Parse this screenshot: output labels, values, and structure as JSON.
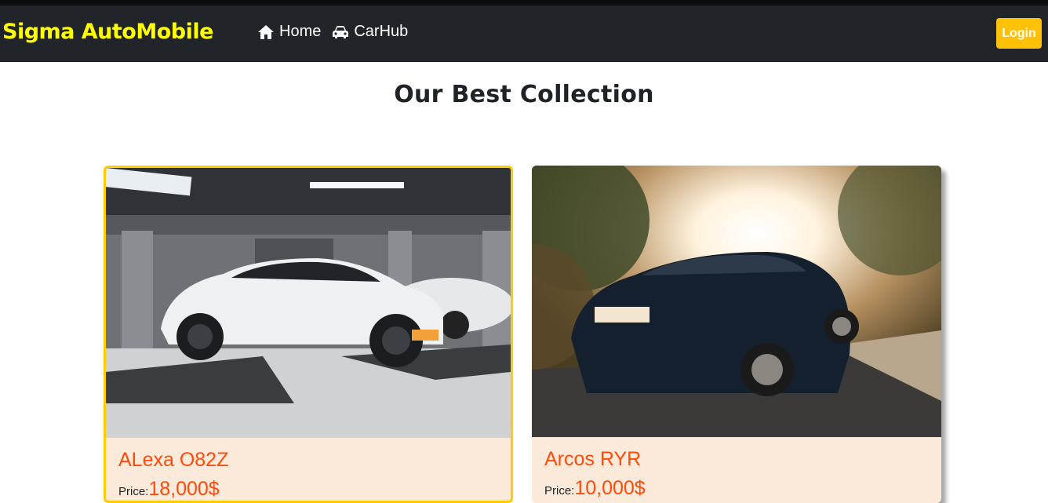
{
  "navbar": {
    "brand": "Sigma AutoMobile",
    "links": [
      {
        "label": "Home",
        "icon": "home-icon"
      },
      {
        "label": "CarHub",
        "icon": "car-icon"
      }
    ],
    "login_label": "Login",
    "colors": {
      "background": "#212529",
      "brand": "#ffff00",
      "login": "#ffc107"
    }
  },
  "main": {
    "heading": "Our Best Collection",
    "cards": [
      {
        "title": "ALexa O82Z",
        "price_label": "Price:",
        "price_value": "18,000$",
        "image": "white-car-in-parking-garage"
      },
      {
        "title": "Arcos RYR",
        "price_label": "Price:",
        "price_value": "10,000$",
        "image": "dark-car-on-sunlit-road"
      }
    ]
  }
}
